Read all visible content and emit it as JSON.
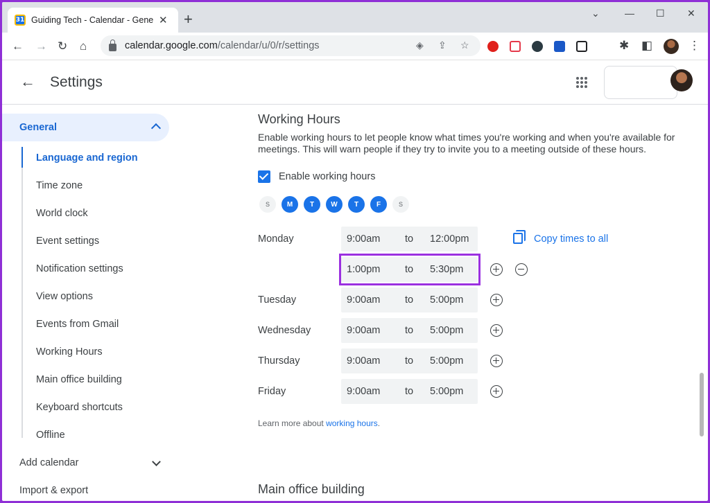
{
  "browser": {
    "tab_title": "Guiding Tech - Calendar - General",
    "favicon_text": "31",
    "url_host": "calendar.google.com",
    "url_path": "/calendar/u/0/r/settings"
  },
  "header": {
    "title": "Settings"
  },
  "sidebar": {
    "general": "General",
    "sub_items": [
      "Language and region",
      "Time zone",
      "World clock",
      "Event settings",
      "Notification settings",
      "View options",
      "Events from Gmail",
      "Working Hours",
      "Main office building",
      "Keyboard shortcuts",
      "Offline"
    ],
    "add_calendar": "Add calendar",
    "import_export": "Import & export"
  },
  "main": {
    "section_title": "Working Hours",
    "description": "Enable working hours to let people know what times you're working and when you're available for meetings. This will warn people if they try to invite you to a meeting outside of these hours.",
    "enable_label": "Enable working hours",
    "enable_checked": true,
    "days": [
      {
        "letter": "S",
        "on": false
      },
      {
        "letter": "M",
        "on": true
      },
      {
        "letter": "T",
        "on": true
      },
      {
        "letter": "W",
        "on": true
      },
      {
        "letter": "T",
        "on": true
      },
      {
        "letter": "F",
        "on": true
      },
      {
        "letter": "S",
        "on": false
      }
    ],
    "to_label": "to",
    "schedule": [
      {
        "day": "Monday",
        "start": "9:00am",
        "end": "12:00pm"
      },
      {
        "day": "",
        "start": "1:00pm",
        "end": "5:30pm"
      },
      {
        "day": "Tuesday",
        "start": "9:00am",
        "end": "5:00pm"
      },
      {
        "day": "Wednesday",
        "start": "9:00am",
        "end": "5:00pm"
      },
      {
        "day": "Thursday",
        "start": "9:00am",
        "end": "5:00pm"
      },
      {
        "day": "Friday",
        "start": "9:00am",
        "end": "5:00pm"
      }
    ],
    "copy_label": "Copy times to all",
    "learn_prefix": "Learn more about ",
    "learn_link": "working hours",
    "learn_suffix": ".",
    "next_section": "Main office building"
  },
  "colors": {
    "accent": "#1a73e8",
    "highlight_border": "#9b30e0"
  }
}
